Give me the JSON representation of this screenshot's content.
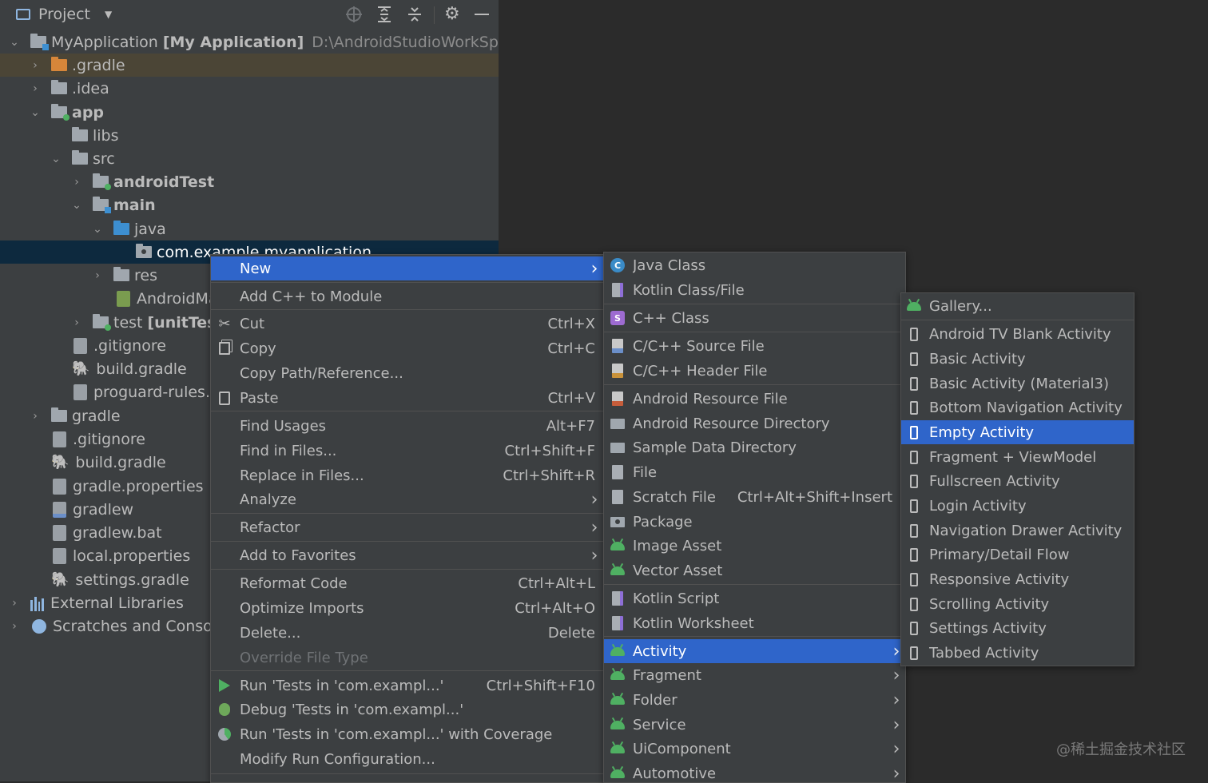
{
  "toolbar": {
    "view_label": "Project",
    "icons": [
      "locate-icon",
      "expand-all-icon",
      "collapse-all-icon",
      "gear-icon",
      "minimize-icon"
    ]
  },
  "tree": {
    "root_name": "MyApplication",
    "root_module": "[My Application]",
    "root_path": "D:\\AndroidStudioWorkSpace\\An",
    "items": {
      "gradle_hidden": ".gradle",
      "idea": ".idea",
      "app": "app",
      "libs": "libs",
      "src": "src",
      "androidTest": "androidTest",
      "main": "main",
      "java": "java",
      "package": "com.example.myapplication",
      "res": "res",
      "manifest": "AndroidMa",
      "test_name": "test",
      "test_tag": "[unitTest]",
      "gitignore_app": ".gitignore",
      "build_gradle_app": "build.gradle",
      "proguard": "proguard-rules.p",
      "gradle": "gradle",
      "gitignore_root": ".gitignore",
      "build_gradle_root": "build.gradle",
      "gradle_properties": "gradle.properties",
      "gradlew": "gradlew",
      "gradlew_bat": "gradlew.bat",
      "local_properties": "local.properties",
      "settings_gradle": "settings.gradle",
      "external_libraries": "External Libraries",
      "scratches": "Scratches and Consoles"
    }
  },
  "context_menu": {
    "items": [
      {
        "label": "New",
        "shortcut": "",
        "submenu": true,
        "highlighted": true,
        "icon": ""
      },
      {
        "label": "Add C++ to Module",
        "shortcut": "",
        "icon": ""
      },
      {
        "label": "Cut",
        "shortcut": "Ctrl+X",
        "icon": "scissors-icon"
      },
      {
        "label": "Copy",
        "shortcut": "Ctrl+C",
        "icon": "copy-icon"
      },
      {
        "label": "Copy Path/Reference...",
        "shortcut": "",
        "icon": ""
      },
      {
        "label": "Paste",
        "shortcut": "Ctrl+V",
        "icon": "paste-icon"
      },
      {
        "label": "Find Usages",
        "shortcut": "Alt+F7",
        "icon": ""
      },
      {
        "label": "Find in Files...",
        "shortcut": "Ctrl+Shift+F",
        "icon": ""
      },
      {
        "label": "Replace in Files...",
        "shortcut": "Ctrl+Shift+R",
        "icon": ""
      },
      {
        "label": "Analyze",
        "shortcut": "",
        "submenu": true,
        "icon": ""
      },
      {
        "label": "Refactor",
        "shortcut": "",
        "submenu": true,
        "icon": ""
      },
      {
        "label": "Add to Favorites",
        "shortcut": "",
        "submenu": true,
        "icon": ""
      },
      {
        "label": "Reformat Code",
        "shortcut": "Ctrl+Alt+L",
        "icon": ""
      },
      {
        "label": "Optimize Imports",
        "shortcut": "Ctrl+Alt+O",
        "icon": ""
      },
      {
        "label": "Delete...",
        "shortcut": "Delete",
        "icon": ""
      },
      {
        "label": "Override File Type",
        "shortcut": "",
        "disabled": true,
        "icon": ""
      },
      {
        "label": "Run 'Tests in 'com.exampl...'",
        "shortcut": "Ctrl+Shift+F10",
        "icon": "run-icon"
      },
      {
        "label": "Debug 'Tests in 'com.exampl...'",
        "shortcut": "",
        "icon": "debug-icon"
      },
      {
        "label": "Run 'Tests in 'com.exampl...' with Coverage",
        "shortcut": "",
        "icon": "coverage-icon"
      },
      {
        "label": "Modify Run Configuration...",
        "shortcut": "",
        "icon": ""
      }
    ]
  },
  "new_submenu": {
    "items": [
      {
        "label": "Java Class",
        "shortcut": "",
        "icon": "java-class-icon"
      },
      {
        "label": "Kotlin Class/File",
        "shortcut": "",
        "icon": "kotlin-file-icon"
      },
      {
        "label": "C++ Class",
        "shortcut": "",
        "icon": "cpp-class-icon"
      },
      {
        "label": "C/C++ Source File",
        "shortcut": "",
        "icon": "cpp-source-icon"
      },
      {
        "label": "C/C++ Header File",
        "shortcut": "",
        "icon": "cpp-header-icon"
      },
      {
        "label": "Android Resource File",
        "shortcut": "",
        "icon": "resource-file-icon"
      },
      {
        "label": "Android Resource Directory",
        "shortcut": "",
        "icon": "folder-icon"
      },
      {
        "label": "Sample Data Directory",
        "shortcut": "",
        "icon": "folder-icon"
      },
      {
        "label": "File",
        "shortcut": "",
        "icon": "file-icon"
      },
      {
        "label": "Scratch File",
        "shortcut": "Ctrl+Alt+Shift+Insert",
        "icon": "scratch-icon"
      },
      {
        "label": "Package",
        "shortcut": "",
        "icon": "package-icon"
      },
      {
        "label": "Image Asset",
        "shortcut": "",
        "icon": "android-icon"
      },
      {
        "label": "Vector Asset",
        "shortcut": "",
        "icon": "android-icon"
      },
      {
        "label": "Kotlin Script",
        "shortcut": "",
        "icon": "kotlin-script-icon"
      },
      {
        "label": "Kotlin Worksheet",
        "shortcut": "",
        "icon": "kotlin-worksheet-icon"
      },
      {
        "label": "Activity",
        "shortcut": "",
        "submenu": true,
        "highlighted": true,
        "icon": "android-icon"
      },
      {
        "label": "Fragment",
        "shortcut": "",
        "submenu": true,
        "icon": "android-icon"
      },
      {
        "label": "Folder",
        "shortcut": "",
        "submenu": true,
        "icon": "android-icon"
      },
      {
        "label": "Service",
        "shortcut": "",
        "submenu": true,
        "icon": "android-icon"
      },
      {
        "label": "UiComponent",
        "shortcut": "",
        "submenu": true,
        "icon": "android-icon"
      },
      {
        "label": "Automotive",
        "shortcut": "",
        "submenu": true,
        "icon": "android-icon"
      }
    ]
  },
  "activity_submenu": {
    "items": [
      {
        "label": "Gallery...",
        "icon": "android-icon"
      },
      {
        "label": "Android TV Blank Activity",
        "icon": "phone-icon"
      },
      {
        "label": "Basic Activity",
        "icon": "phone-icon"
      },
      {
        "label": "Basic Activity (Material3)",
        "icon": "phone-icon"
      },
      {
        "label": "Bottom Navigation Activity",
        "icon": "phone-icon"
      },
      {
        "label": "Empty Activity",
        "icon": "phone-icon",
        "highlighted": true
      },
      {
        "label": "Fragment + ViewModel",
        "icon": "phone-icon"
      },
      {
        "label": "Fullscreen Activity",
        "icon": "phone-icon"
      },
      {
        "label": "Login Activity",
        "icon": "phone-icon"
      },
      {
        "label": "Navigation Drawer Activity",
        "icon": "phone-icon"
      },
      {
        "label": "Primary/Detail Flow",
        "icon": "phone-icon"
      },
      {
        "label": "Responsive Activity",
        "icon": "phone-icon"
      },
      {
        "label": "Scrolling Activity",
        "icon": "phone-icon"
      },
      {
        "label": "Settings Activity",
        "icon": "phone-icon"
      },
      {
        "label": "Tabbed Activity",
        "icon": "phone-icon"
      }
    ]
  },
  "watermark": "@稀土掘金技术社区",
  "colors": {
    "panel_bg": "#3c3f41",
    "editor_bg": "#2b2b2b",
    "highlight": "#2f65ca",
    "selected_row": "#0d293e",
    "android_green": "#4fb062"
  }
}
